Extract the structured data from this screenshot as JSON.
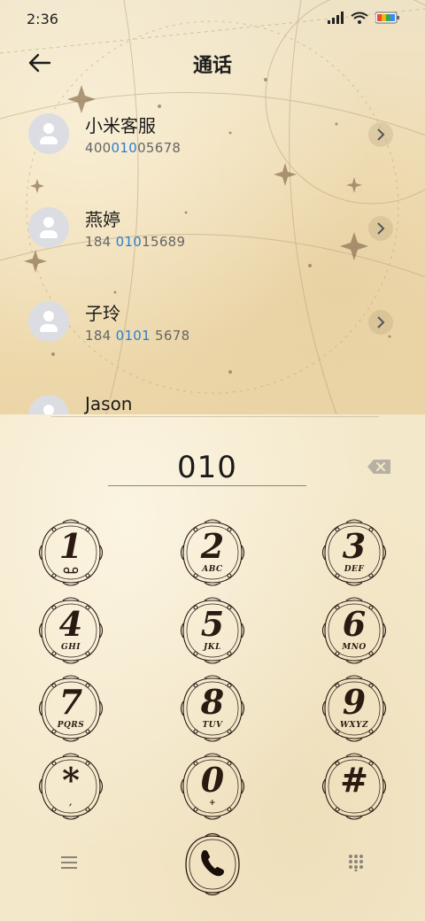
{
  "status_bar": {
    "time": "2:36"
  },
  "header": {
    "title": "通话"
  },
  "contacts": [
    {
      "name": "小米客服",
      "number_pre": "400",
      "number_hl": "010",
      "number_post": "05678"
    },
    {
      "name": "燕婷",
      "number_pre": "184 ",
      "number_hl": "010",
      "number_post": "15689"
    },
    {
      "name": "子玲",
      "number_pre": "184 ",
      "number_hl": "0101",
      "number_post": " 5678"
    },
    {
      "name": "Jason",
      "number_pre": "",
      "number_hl": "",
      "number_post": ""
    }
  ],
  "dialer": {
    "digits": "010",
    "keys": [
      {
        "digit": "1",
        "letters": ""
      },
      {
        "digit": "2",
        "letters": "ABC"
      },
      {
        "digit": "3",
        "letters": "DEF"
      },
      {
        "digit": "4",
        "letters": "GHI"
      },
      {
        "digit": "5",
        "letters": "JKL"
      },
      {
        "digit": "6",
        "letters": "MNO"
      },
      {
        "digit": "7",
        "letters": "PQRS"
      },
      {
        "digit": "8",
        "letters": "TUV"
      },
      {
        "digit": "9",
        "letters": "WXYZ"
      },
      {
        "digit": "*",
        "letters": ","
      },
      {
        "digit": "0",
        "letters": "+"
      },
      {
        "digit": "#",
        "letters": ""
      }
    ]
  },
  "icons": {
    "back": "arrow-left-icon",
    "backspace": "backspace-icon",
    "call": "phone-icon",
    "menu": "menu-icon",
    "keypad": "keypad-grid-icon",
    "voicemail": "voicemail-icon"
  },
  "colors": {
    "highlight": "#2a7ed1",
    "ink": "#2a1a12",
    "parchment": "#f4e8ca"
  }
}
